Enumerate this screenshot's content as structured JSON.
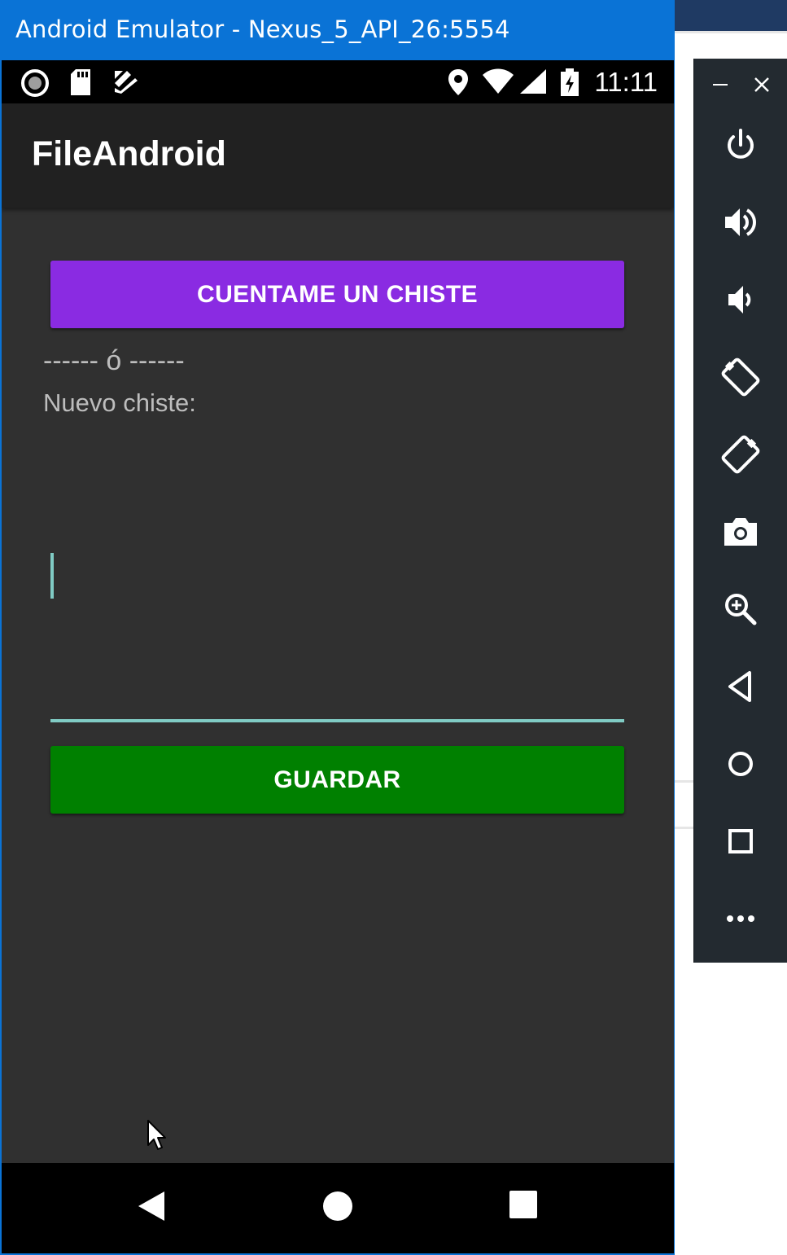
{
  "window": {
    "title": "Android Emulator - Nexus_5_API_26:5554"
  },
  "status_bar": {
    "time": "11:11"
  },
  "app": {
    "title": "FileAndroid"
  },
  "main": {
    "joke_button": "CUENTAME UN CHISTE",
    "separator": "------ ó ------",
    "new_joke_label": "Nuevo chiste:",
    "new_joke_value": "",
    "save_button": "GUARDAR"
  },
  "colors": {
    "title_bar": "#0a73d6",
    "joke_button": "#8a2be2",
    "save_button": "#008000",
    "accent": "#80cbc4"
  },
  "toolbar_icons": [
    "minimize-icon",
    "close-icon",
    "power-icon",
    "volume-up-icon",
    "volume-down-icon",
    "rotate-left-icon",
    "rotate-right-icon",
    "camera-icon",
    "zoom-icon",
    "back-icon",
    "home-icon",
    "overview-icon",
    "more-icon"
  ]
}
